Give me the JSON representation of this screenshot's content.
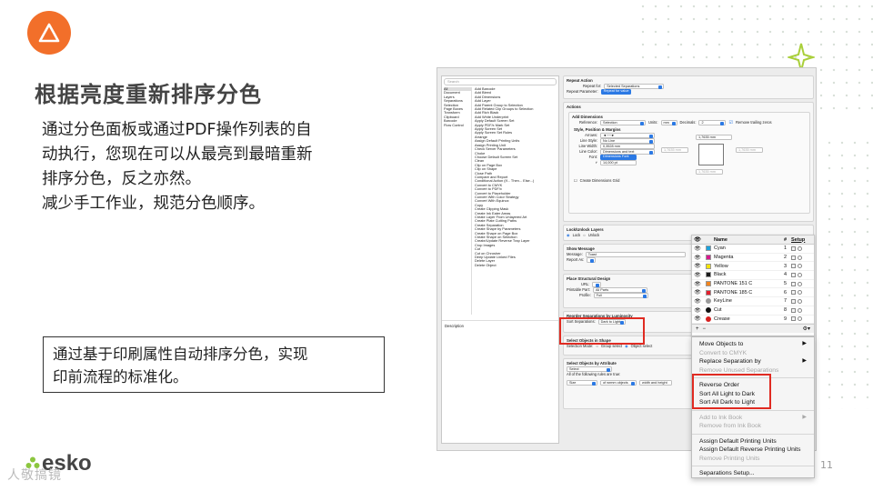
{
  "slide": {
    "title": "根据亮度重新排序分色",
    "body": [
      "通过分色面板或通过PDF操作列表的自",
      "动执行，您现在可以从最亮到最暗重新",
      "排序分色，反之亦然。",
      "减少手工作业，规范分色顺序。"
    ],
    "callout": [
      "通过基于印刷属性自动排序分色，实现",
      "印前流程的标准化。"
    ],
    "brand": "esko",
    "watermark": "人敬搞镜",
    "page_number": "11",
    "colors": {
      "accent": "#f26f2a",
      "highlight": "#e02b22",
      "select_blue": "#2b79e4"
    }
  },
  "app": {
    "search_placeholder": "Search",
    "categories": [
      "All",
      "Document",
      "Layers",
      "Separations",
      "Selection",
      "Page Boxes",
      "Transform",
      "Clipboard",
      "Barcode",
      "Flow Control"
    ],
    "actions": [
      "Add Barcode",
      "Add Bleed",
      "Add Dimensions",
      "Add Layer",
      "Add Parent Group to Selection",
      "Add Related Clip Groups to Selection",
      "Add Rich Black",
      "Add White Underprint",
      "Apply Default Screen Set",
      "Apply PDF/x Mark Set",
      "Apply Screen Set",
      "Apply Screen Set Rules",
      "Arrange",
      "Assign Default Printing Units",
      "Assign Printing Unit",
      "Check Server Parameters",
      "Choke",
      "Choose Default Screen Set",
      "Clean",
      "Clip on Page Box",
      "Clip on Shape",
      "Close Path",
      "Compare and Report",
      "Conditional Action (If... Then... Else...)",
      "Convert to CMYK",
      "Convert to PDF/x",
      "Convert to Placeholder",
      "Convert With Color Strategy",
      "Convert With Equinox",
      "Copy",
      "Create Clipping Mask",
      "Create Ink Eater Areas",
      "Create Layer From Unlayered Art",
      "Create Plate Cutting Paths",
      "Create Separation",
      "Create Shape by Parameters",
      "Create Shape on Page Box",
      "Create Shape on Selection",
      "Create/Update Reverse Trap Layer",
      "Crop Images",
      "Cut",
      "Cut on Chrosher",
      "Deep Update Linked Files",
      "Delete Layer",
      "Delete Object"
    ],
    "description_label": "Description",
    "repeat_action": {
      "header": "Repeat Action",
      "repeat_for_label": "Repeat for:",
      "repeat_for_value": "Selected Separations",
      "repeat_param_label": "Repeat Parameter:",
      "repeat_param_value": "Repeat for value"
    },
    "actions_header": "Actions",
    "add_dimensions": {
      "header": "Add Dimensions",
      "reference_label": "Reference:",
      "reference_value": "Selection",
      "units_label": "Units:",
      "units_value": "mm",
      "decimals_label": "Decimals:",
      "decimals_value": "2",
      "remove_zeros": "Remove trailing zeros",
      "style_header": "Style, Position & Margins",
      "arrows_label": "Arrows:",
      "line_style_label": "Line Style:",
      "line_style_value": "No Line",
      "line_width_label": "Line Width:",
      "line_width_value": "0,3528 mm",
      "line_color_label": "Line Color:",
      "line_color_value": "Dimensions and text",
      "font_label": "Font:",
      "font_value": "Dimensions Font",
      "font_size": "14,000 pt",
      "margin_top": "1,7635 mm",
      "margin_left": "1,7635 mm",
      "margin_right": "1,7635 mm",
      "margin_bottom": "1,7635 mm",
      "create_grid": "Create Dimensions Grid"
    },
    "lock_unlock": {
      "header": "Lock/Unlock Layers",
      "lock": "Lock",
      "unlock": "Unlock"
    },
    "show_message": {
      "header": "Show Message",
      "message_label": "Message:",
      "message_value": "Toast",
      "report_as_label": "Report As:"
    },
    "place_structural": {
      "header": "Place Structural Design",
      "url_label": "URL:",
      "printable_label": "Printable Part:",
      "printable_value": "All Parts",
      "profile_label": "Profile:",
      "profile_value": "Full"
    },
    "reorder": {
      "header": "Reorder Separations by Luminosity",
      "sort_label": "Sort Separations:",
      "sort_value": "Dark to Light"
    },
    "select_objects_shape": {
      "header": "Select Objects in Shape",
      "mode_label": "Selection Mode:",
      "group_select": "Group select",
      "object_select": "Object select"
    },
    "select_objects_attr": {
      "header": "Select Objects by Attribute",
      "select_value": "Select",
      "rule_text": "All of the following rules are true:",
      "size_value": "Size",
      "of_wmm": "of wrmm objects",
      "width_height": "width and height"
    }
  },
  "separations": {
    "headers": {
      "name": "Name",
      "num": "#",
      "setup": "Setup"
    },
    "rows": [
      {
        "name": "Cyan",
        "num": "1",
        "color": "#1ea2dc",
        "kind": "square"
      },
      {
        "name": "Magenta",
        "num": "2",
        "color": "#d7198c",
        "kind": "square"
      },
      {
        "name": "Yellow",
        "num": "3",
        "color": "#f5e400",
        "kind": "square"
      },
      {
        "name": "Black",
        "num": "4",
        "color": "#1a1a1a",
        "kind": "square"
      },
      {
        "name": "PANTONE 151 C",
        "num": "5",
        "color": "#f2851e",
        "kind": "square"
      },
      {
        "name": "PANTONE 185 C",
        "num": "6",
        "color": "#e3202e",
        "kind": "square"
      },
      {
        "name": "KeyLine",
        "num": "7",
        "color": "#9a9a9a",
        "kind": "dot"
      },
      {
        "name": "Cut",
        "num": "8",
        "color": "#111111",
        "kind": "dot"
      },
      {
        "name": "Crease",
        "num": "9",
        "color": "#d62020",
        "kind": "dot"
      }
    ]
  },
  "context_menu": {
    "group1": [
      {
        "label": "Move Objects to",
        "disabled": false,
        "submenu": true
      },
      {
        "label": "Convert to CMYK",
        "disabled": true,
        "submenu": false
      },
      {
        "label": "Replace Separation by",
        "disabled": false,
        "submenu": true
      },
      {
        "label": "Remove Unused Separations",
        "disabled": true,
        "submenu": false
      }
    ],
    "group2": [
      {
        "label": "Reverse Order",
        "disabled": false
      },
      {
        "label": "Sort All Light to Dark",
        "disabled": false
      },
      {
        "label": "Sort All Dark to Light",
        "disabled": false
      }
    ],
    "group3": [
      {
        "label": "Add to Ink Book",
        "disabled": true,
        "submenu": true
      },
      {
        "label": "Remove from Ink Book",
        "disabled": true,
        "submenu": false
      }
    ],
    "group4": [
      {
        "label": "Assign Default Printing Units",
        "disabled": false
      },
      {
        "label": "Assign Default Reverse Printing Units",
        "disabled": false
      },
      {
        "label": "Remove Printing Units",
        "disabled": true
      }
    ],
    "group5": [
      {
        "label": "Separations Setup...",
        "disabled": false
      }
    ]
  }
}
